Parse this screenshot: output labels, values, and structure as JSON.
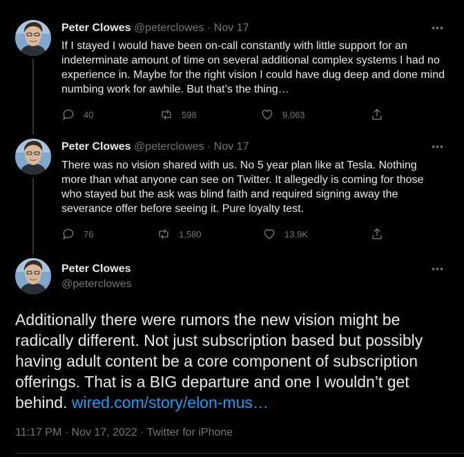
{
  "tweets": [
    {
      "author_name": "Peter Clowes",
      "handle": "@peterclowes",
      "date": "Nov 17",
      "text": "If I stayed I would have been on-call constantly with little support for an indeterminate amount of time on several additional complex systems I had no experience in. Maybe for the right vision I could have dug deep and done mind numbing work for awhile. But that’s the thing…",
      "replies": "40",
      "retweets": "598",
      "likes": "9,063"
    },
    {
      "author_name": "Peter Clowes",
      "handle": "@peterclowes",
      "date": "Nov 17",
      "text": "There was no vision shared with us. No 5 year plan like at Tesla. Nothing more than what anyone can see on Twitter. It allegedly is coming for those who stayed but the ask was blind faith and required signing away the severance offer before seeing it. Pure loyalty test.",
      "replies": "76",
      "retweets": "1,580",
      "likes": "13.9K"
    }
  ],
  "main_tweet": {
    "author_name": "Peter Clowes",
    "handle": "@peterclowes",
    "text": "Additionally there were rumors the new vision might be radically different. Not just subscription based but possibly having adult content be a core component of subscription offerings. That is a BIG departure and one I wouldn’t get behind.",
    "link_text": "wired.com/story/elon-mus…",
    "time": "11:17 PM",
    "date": "Nov 17, 2022",
    "source": "Twitter for iPhone"
  },
  "separators": {
    "dot": "·",
    "more": "•••"
  },
  "icons": {
    "reply": "reply-icon",
    "retweet": "retweet-icon",
    "like": "heart-icon",
    "share": "share-icon",
    "more": "more-icon"
  },
  "colors": {
    "background": "#000000",
    "text": "#e7e9ea",
    "muted": "#71767b",
    "link": "#1d9bf0"
  }
}
